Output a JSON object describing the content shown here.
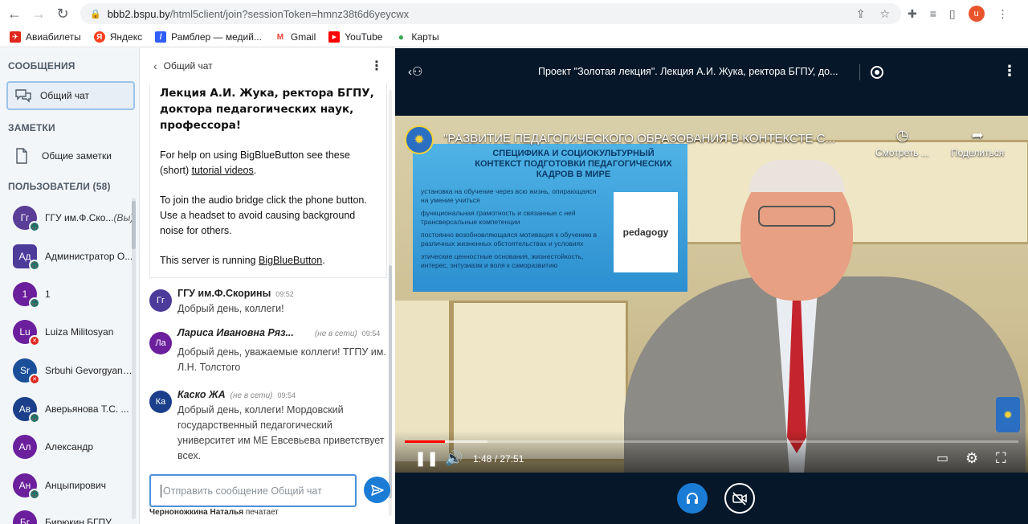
{
  "browser": {
    "url_host": "bbb2.bspu.by",
    "url_path": "/html5client/join?sessionToken=hmnz38t6d6yeycwx",
    "profile_letter": "u",
    "bookmarks": [
      {
        "label": "Авиабилеты",
        "color": "#e0251b",
        "glyph": "✈"
      },
      {
        "label": "Яндекс",
        "color": "#fc3f1d",
        "glyph": "Я"
      },
      {
        "label": "Рамблер — медий...",
        "color": "#315efb",
        "glyph": "/"
      },
      {
        "label": "Gmail",
        "color": "#ea4335",
        "glyph": "M"
      },
      {
        "label": "YouTube",
        "color": "#ff0000",
        "glyph": "▶"
      },
      {
        "label": "Карты",
        "color": "#34a853",
        "glyph": "●"
      }
    ]
  },
  "sidebar": {
    "messages_title": "СООБЩЕНИЯ",
    "public_chat_label": "Общий чат",
    "notes_title": "ЗАМЕТКИ",
    "shared_notes_label": "Общие заметки",
    "users_title": "ПОЛЬЗОВАТЕЛИ (58)",
    "users": [
      {
        "initials": "Гг",
        "name": "ГГУ им.Ф.Ско...",
        "you": "(Вы)",
        "color": "#5a3d96",
        "badge": "ok",
        "square": false
      },
      {
        "initials": "Ад",
        "name": "Администратор О...",
        "you": "",
        "color": "#4d3b9a",
        "badge": "ok",
        "square": true
      },
      {
        "initials": "1",
        "name": "1",
        "you": "",
        "color": "#6b1f9c",
        "badge": "ok",
        "square": false
      },
      {
        "initials": "Lu",
        "name": "Luiza Militosyan",
        "you": "",
        "color": "#6b1f9c",
        "badge": "mute",
        "square": false
      },
      {
        "initials": "Sr",
        "name": "Srbuhi Gevorgyan, ...",
        "you": "",
        "color": "#1b4f9a",
        "badge": "mute",
        "square": false
      },
      {
        "initials": "Ав",
        "name": "Аверьянова Т.С. ...",
        "you": "",
        "color": "#1b3f8a",
        "badge": "ok",
        "square": false
      },
      {
        "initials": "Ал",
        "name": "Александр",
        "you": "",
        "color": "#6b1f9c",
        "badge": "",
        "square": false
      },
      {
        "initials": "Ан",
        "name": "Анцыпирович",
        "you": "",
        "color": "#6b1f9c",
        "badge": "ok",
        "square": false
      },
      {
        "initials": "Бг",
        "name": "Бирюкин БГПУ",
        "you": "",
        "color": "#6b1f9c",
        "badge": "",
        "square": false
      }
    ]
  },
  "chat": {
    "header": "Общий чат",
    "welcome_heading": "Лекция А.И. Жука, ректора БГПУ, доктора педагогических наук, профессора!",
    "welcome_help_pre": "For help on using BigBlueButton see these (short) ",
    "welcome_help_link": "tutorial videos",
    "welcome_help_post": ".",
    "welcome_audio": "To join the audio bridge click the phone button. Use a headset to avoid causing background noise for others.",
    "welcome_server_pre": "This server is running ",
    "welcome_server_link": "BigBlueButton",
    "welcome_server_post": ".",
    "messages": [
      {
        "initials": "Гг",
        "author": "ГГУ им.Ф.Скорины",
        "offline": "",
        "time": "09:52",
        "text": "Добрый день, коллеги!",
        "color": "#4d3b9a"
      },
      {
        "initials": "Ла",
        "author": "Лариса Ивановна Ряз...",
        "offline": "(не в сети)",
        "time": "09:54",
        "text": "Добрый день, уважаемые коллеги! ТГПУ им. Л.Н. Толстого",
        "color": "#6b1f9c"
      },
      {
        "initials": "Ка",
        "author": "Каско ЖА",
        "offline": "(не в сети)",
        "time": "09:54",
        "text": "Добрый день, коллеги! Мордовский государственный педагогический университет им МЕ Евсевьева приветствует всех.",
        "color": "#1b3f8a"
      }
    ],
    "input_placeholder": "Отправить сообщение Общий чат",
    "typing_user": "Черноножкина Наталья",
    "typing_suffix": "печатает"
  },
  "presentation": {
    "title": "Проект \"Золотая лекция\". Лекция А.И. Жука, ректора БГПУ, до...",
    "video_title": "\"РАЗВИТИЕ ПЕДАГОГИЧЕСКОГО ОБРАЗОВАНИЯ В КОНТЕКСТЕ С...",
    "watch_later": "Смотреть ...",
    "share": "Поделиться",
    "slide_title": "СПЕЦИФИКА И СОЦИОКУЛЬТУРНЫЙ КОНТЕКСТ ПОДГОТОВКИ ПЕДАГОГИЧЕСКИХ КАДРОВ В МИРЕ",
    "slide_items": [
      "установка на обучение через всю жизнь, опирающаяся на умение учиться",
      "функциональная грамотность и связанные с ней трансверсальные компетенции",
      "постоянно возобновляющаяся мотивация к обучению в различных жизненных обстоятельствах и условиях",
      "этические ценностные основания, жизнестойкость, интерес, энтузиазм и воля к саморазвитию"
    ],
    "slide_cloud_word": "pedagogy",
    "time_display": "1:48 / 27:51",
    "progress_played": 0.065,
    "progress_buffered": 0.135
  },
  "colors": {
    "accent_blue": "#1b7cd6",
    "panel_dark": "#06172a",
    "yt_red": "#ff0000"
  }
}
